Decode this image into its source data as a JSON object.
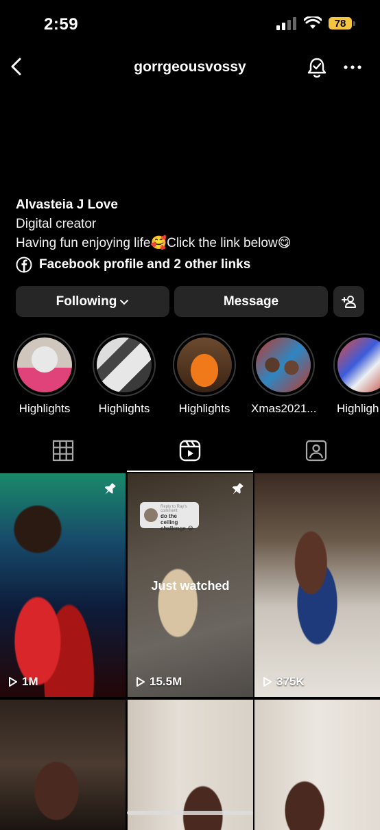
{
  "status_bar": {
    "time": "2:59",
    "battery": "78"
  },
  "header": {
    "username": "gorrgeousvossy"
  },
  "profile": {
    "name": "Alvasteia J Love",
    "category": "Digital creator",
    "bio": "Having fun enjoying life🥰Click the link below😋",
    "links_text": "Facebook profile and 2 other links"
  },
  "buttons": {
    "following": "Following",
    "message": "Message"
  },
  "highlights": [
    {
      "label": "Highlights"
    },
    {
      "label": "Highlights"
    },
    {
      "label": "Highlights"
    },
    {
      "label": "Xmas2021..."
    },
    {
      "label": "Highligh"
    }
  ],
  "tabs": [
    "grid",
    "reels",
    "tagged"
  ],
  "reels": [
    {
      "views": "1M",
      "pinned": true
    },
    {
      "views": "15.5M",
      "pinned": true,
      "overlay": "Just watched",
      "reply_title": "Reply to Ray's comment",
      "reply_text": "do the ceiling challenge 😂"
    },
    {
      "views": "375K",
      "pinned": false
    }
  ],
  "colors": {
    "background": "#000000",
    "button": "#262626",
    "battery": "#f5c542"
  },
  "icons": [
    "back-arrow-icon",
    "bell-check-icon",
    "more-icon",
    "facebook-icon",
    "chevron-down-icon",
    "add-person-icon",
    "grid-icon",
    "reels-icon",
    "tagged-icon",
    "pin-icon",
    "play-icon"
  ]
}
